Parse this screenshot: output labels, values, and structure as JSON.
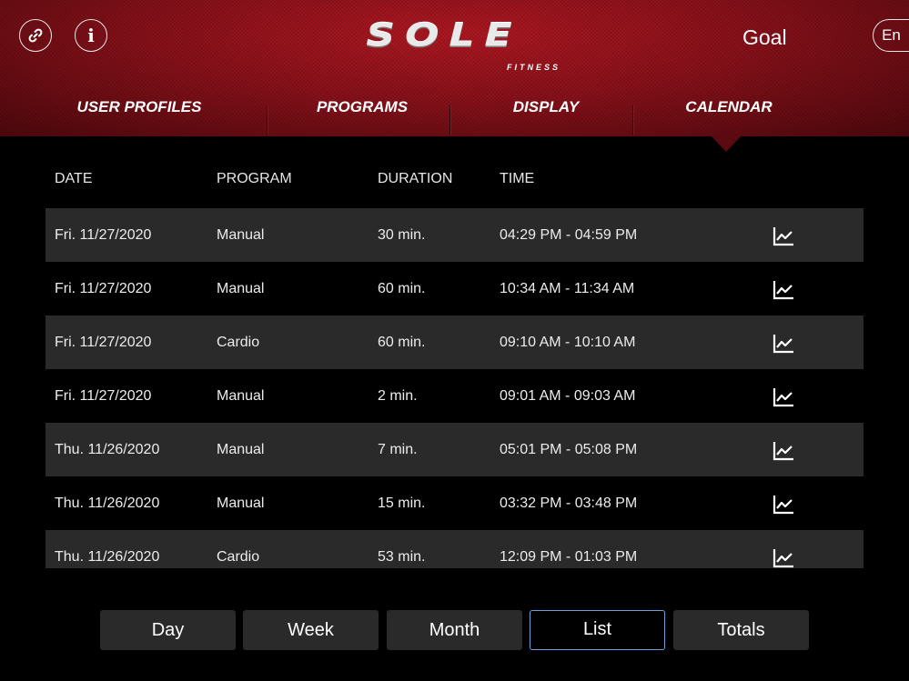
{
  "header": {
    "logo_text": "SOLE",
    "logo_sub": "FITNESS",
    "goal_label": "Goal",
    "lang_label": "En",
    "info_glyph": "i",
    "link_icon": "link-icon",
    "info_icon": "info-icon"
  },
  "nav": {
    "tabs": [
      {
        "label": "USER PROFILES"
      },
      {
        "label": "PROGRAMS"
      },
      {
        "label": "DISPLAY"
      },
      {
        "label": "CALENDAR"
      }
    ],
    "active_tab": "CALENDAR"
  },
  "table": {
    "headers": {
      "date": "DATE",
      "program": "PROGRAM",
      "duration": "DURATION",
      "time": "TIME"
    },
    "rows": [
      {
        "date": "Fri. 11/27/2020",
        "program": "Manual",
        "duration": "30 min.",
        "time": "04:29 PM - 04:59 PM"
      },
      {
        "date": "Fri. 11/27/2020",
        "program": "Manual",
        "duration": "60 min.",
        "time": "10:34 AM - 11:34 AM"
      },
      {
        "date": "Fri. 11/27/2020",
        "program": "Cardio",
        "duration": "60 min.",
        "time": "09:10 AM - 10:10 AM"
      },
      {
        "date": "Fri. 11/27/2020",
        "program": "Manual",
        "duration": "2 min.",
        "time": "09:01 AM - 09:03 AM"
      },
      {
        "date": "Thu. 11/26/2020",
        "program": "Manual",
        "duration": "7 min.",
        "time": "05:01 PM - 05:08 PM"
      },
      {
        "date": "Thu. 11/26/2020",
        "program": "Manual",
        "duration": "15 min.",
        "time": "03:32 PM - 03:48 PM"
      },
      {
        "date": "Thu. 11/26/2020",
        "program": "Cardio",
        "duration": "53 min.",
        "time": "12:09 PM - 01:03 PM"
      }
    ],
    "row_icon": "chart-icon"
  },
  "bottom_tabs": {
    "items": [
      {
        "label": "Day"
      },
      {
        "label": "Week"
      },
      {
        "label": "Month"
      },
      {
        "label": "List"
      },
      {
        "label": "Totals"
      }
    ],
    "active": "List"
  },
  "colors": {
    "header_red": "#8a111a",
    "row_dark": "#2a2a2a",
    "active_border": "#6aa3d8"
  }
}
